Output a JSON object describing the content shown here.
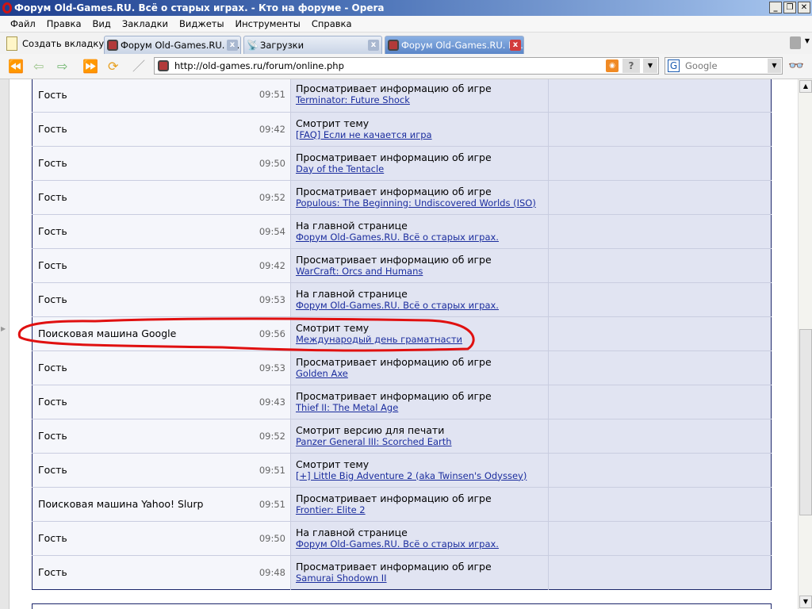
{
  "window": {
    "title": "Форум Old-Games.RU. Всё о старых играх. - Кто на форуме - Opera"
  },
  "menu": [
    "Файл",
    "Правка",
    "Вид",
    "Закладки",
    "Виджеты",
    "Инструменты",
    "Справка"
  ],
  "tabs": {
    "new_tab": "Создать вкладку",
    "items": [
      {
        "label": "Форум Old-Games.RU. В..."
      },
      {
        "label": "Загрузки"
      },
      {
        "label": "Форум Old-Games.RU. В..."
      }
    ]
  },
  "address": {
    "url": "http://old-games.ru/forum/online.php"
  },
  "search": {
    "placeholder": "Google"
  },
  "rows": [
    {
      "who": "Гость",
      "time": "09:51",
      "action": "Просматривает информацию об игре",
      "link": "Terminator: Future Shock"
    },
    {
      "who": "Гость",
      "time": "09:42",
      "action": "Смотрит тему",
      "link": "[FAQ] Если не качается игра"
    },
    {
      "who": "Гость",
      "time": "09:50",
      "action": "Просматривает информацию об игре",
      "link": "Day of the Tentacle"
    },
    {
      "who": "Гость",
      "time": "09:52",
      "action": "Просматривает информацию об игре",
      "link": "Populous: The Beginning: Undiscovered Worlds (ISO)"
    },
    {
      "who": "Гость",
      "time": "09:54",
      "action": "На главной странице",
      "link": "Форум Old-Games.RU. Всё о старых играх."
    },
    {
      "who": "Гость",
      "time": "09:42",
      "action": "Просматривает информацию об игре",
      "link": "WarCraft: Orcs and Humans"
    },
    {
      "who": "Гость",
      "time": "09:53",
      "action": "На главной странице",
      "link": "Форум Old-Games.RU. Всё о старых играх."
    },
    {
      "who": "Поисковая машина Google",
      "time": "09:56",
      "action": "Смотрит тему",
      "link": "Международый день граматнасти"
    },
    {
      "who": "Гость",
      "time": "09:53",
      "action": "Просматривает информацию об игре",
      "link": "Golden Axe"
    },
    {
      "who": "Гость",
      "time": "09:43",
      "action": "Просматривает информацию об игре",
      "link": "Thief II: The Metal Age"
    },
    {
      "who": "Гость",
      "time": "09:52",
      "action": "Смотрит версию для печати",
      "link": "Panzer General III: Scorched Earth"
    },
    {
      "who": "Гость",
      "time": "09:51",
      "action": "Смотрит тему",
      "link": "[+] Little Big Adventure 2 (aka Twinsen's Odyssey)"
    },
    {
      "who": "Поисковая машина Yahoo! Slurp",
      "time": "09:51",
      "action": "Просматривает информацию об игре",
      "link": "Frontier: Elite 2"
    },
    {
      "who": "Гость",
      "time": "09:50",
      "action": "На главной странице",
      "link": "Форум Old-Games.RU. Всё о старых играх."
    },
    {
      "who": "Гость",
      "time": "09:48",
      "action": "Просматривает информацию об игре",
      "link": "Samurai Shodown II"
    }
  ],
  "colors": {
    "highlight": "#e01010",
    "link": "#1b2d9e",
    "border": "#1b256a"
  }
}
